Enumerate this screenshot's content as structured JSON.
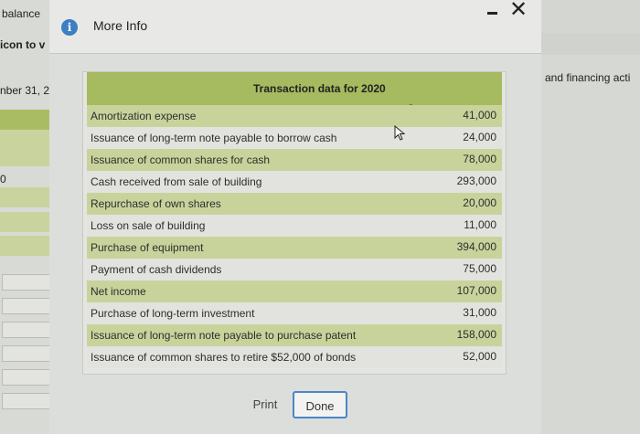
{
  "background": {
    "text_balance": "balance",
    "text_icon": "icon to v",
    "text_number": "nber 31, 2",
    "text_zero": "0",
    "text_right": "and financing acti"
  },
  "dialog": {
    "title": "More Info",
    "close_glyph": "✕",
    "table_title": "Transaction data for 2020",
    "currency": "$",
    "rows": [
      {
        "label": "Amortization expense",
        "value": "41,000"
      },
      {
        "label": "Issuance of long-term note payable to borrow cash",
        "value": "24,000"
      },
      {
        "label": "Issuance of common shares for cash",
        "value": "78,000"
      },
      {
        "label": "Cash received from sale of building",
        "value": "293,000"
      },
      {
        "label": "Repurchase of own shares",
        "value": "20,000"
      },
      {
        "label": "Loss on sale of building",
        "value": "11,000"
      },
      {
        "label": "Purchase of equipment",
        "value": "394,000"
      },
      {
        "label": "Payment of cash dividends",
        "value": "75,000"
      },
      {
        "label": "Net income",
        "value": "107,000"
      },
      {
        "label": "Purchase of long-term investment",
        "value": "31,000"
      },
      {
        "label": "Issuance of long-term note payable to purchase patent",
        "value": "158,000"
      },
      {
        "label": "Issuance of common shares to retire $52,000 of bonds",
        "value": "52,000"
      }
    ],
    "print_label": "Print",
    "done_label": "Done"
  },
  "colors": {
    "header_green": "#a6ba5f",
    "row_green": "#c8d39c",
    "done_border": "#4b86c8",
    "info_blue": "#3c7fc3"
  }
}
